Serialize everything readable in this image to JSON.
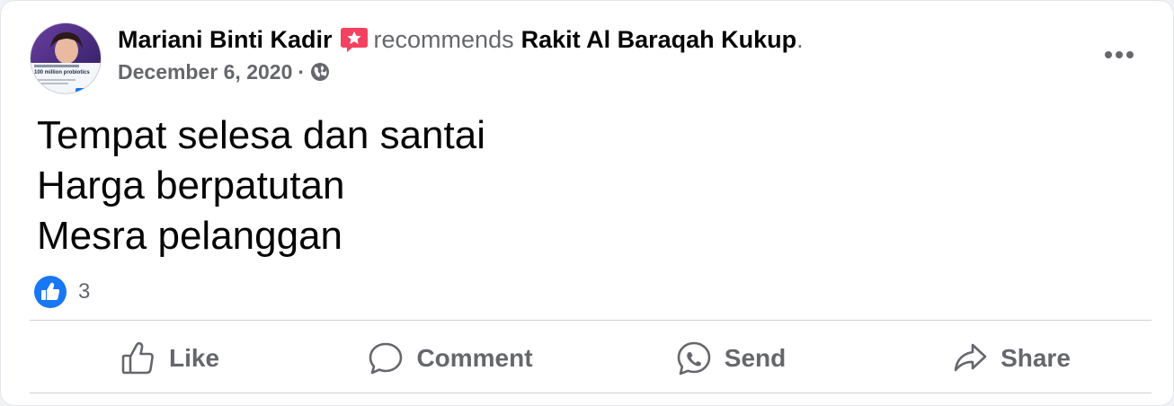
{
  "post": {
    "author": "Mariani Binti Kadir",
    "recommends_text": "recommends",
    "page_name": "Rakit Al Baraqah Kukup",
    "page_name_suffix": ".",
    "date": "December 6, 2020",
    "meta_separator": "·",
    "privacy_icon": "globe-icon",
    "lines": [
      "Tempat selesa dan santai",
      "Harga berpatutan",
      "Mesra pelanggan"
    ]
  },
  "avatar": {
    "thumbnail_heading": "100 million probiotics"
  },
  "reactions": {
    "icon": "like-reaction-icon",
    "count": "3",
    "accent_color": "#1877f2"
  },
  "badge": {
    "icon": "recommend-star-icon",
    "color": "#f3425f"
  },
  "actions": [
    {
      "label": "Like",
      "icon": "thumbs-up-icon"
    },
    {
      "label": "Comment",
      "icon": "comment-icon"
    },
    {
      "label": "Send",
      "icon": "messenger-icon"
    },
    {
      "label": "Share",
      "icon": "share-icon"
    }
  ],
  "more_menu_icon": "more-horizontal-icon"
}
